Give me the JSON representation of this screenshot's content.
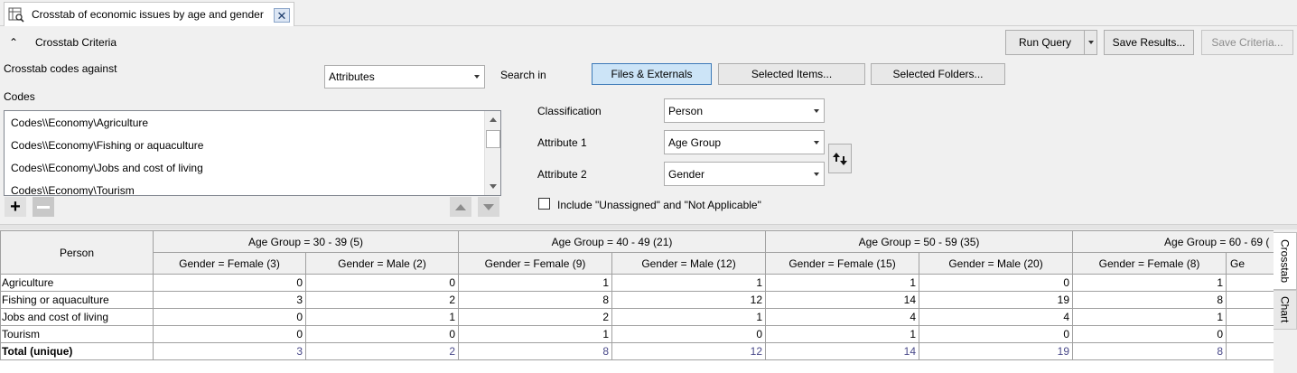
{
  "tab": {
    "title": "Crosstab of economic issues by age and gender",
    "icon": "crosstab-query-icon",
    "close_icon": "close-icon"
  },
  "criteria": {
    "header": "Crosstab Criteria",
    "crosstab_codes_against_label": "Crosstab codes against",
    "crosstab_type_value": "Attributes",
    "search_in_label": "Search in",
    "search_buttons": [
      "Files & Externals",
      "Selected Items...",
      "Selected Folders..."
    ],
    "codes_label": "Codes",
    "codes": [
      "Codes\\\\Economy\\Agriculture",
      "Codes\\\\Economy\\Fishing or aquaculture",
      "Codes\\\\Economy\\Jobs and cost of living",
      "Codes\\\\Economy\\Tourism"
    ],
    "classification_label": "Classification",
    "classification_value": "Person",
    "attribute1_label": "Attribute 1",
    "attribute1_value": "Age Group",
    "attribute2_label": "Attribute 2",
    "attribute2_value": "Gender",
    "include_unassigned_label": "Include \"Unassigned\" and \"Not Applicable\"",
    "include_unassigned_checked": false
  },
  "toolbar": {
    "run_query": "Run Query",
    "save_results": "Save Results...",
    "save_criteria": "Save Criteria..."
  },
  "grid": {
    "corner_label": "Person",
    "age_groups": [
      "Age Group = 30 - 39 (5)",
      "Age Group = 40 - 49 (21)",
      "Age Group = 50 - 59 (35)",
      "Age Group = 60 - 69 ("
    ],
    "gender_headers": [
      "Gender = Female (3)",
      "Gender = Male (2)",
      "Gender = Female (9)",
      "Gender = Male (12)",
      "Gender = Female (15)",
      "Gender = Male (20)",
      "Gender = Female (8)",
      "Ge"
    ],
    "rows": [
      {
        "label": "Agriculture",
        "values": [
          "0",
          "0",
          "1",
          "1",
          "1",
          "0",
          "1",
          ""
        ]
      },
      {
        "label": "Fishing or aquaculture",
        "values": [
          "3",
          "2",
          "8",
          "12",
          "14",
          "19",
          "8",
          ""
        ]
      },
      {
        "label": "Jobs and cost of living",
        "values": [
          "0",
          "1",
          "2",
          "1",
          "4",
          "4",
          "1",
          ""
        ]
      },
      {
        "label": "Tourism",
        "values": [
          "0",
          "0",
          "1",
          "0",
          "1",
          "0",
          "0",
          ""
        ]
      }
    ],
    "total": {
      "label": "Total (unique)",
      "values": [
        "3",
        "2",
        "8",
        "12",
        "14",
        "19",
        "8",
        ""
      ]
    }
  },
  "side_tabs": [
    "Crosstab",
    "Chart"
  ]
}
